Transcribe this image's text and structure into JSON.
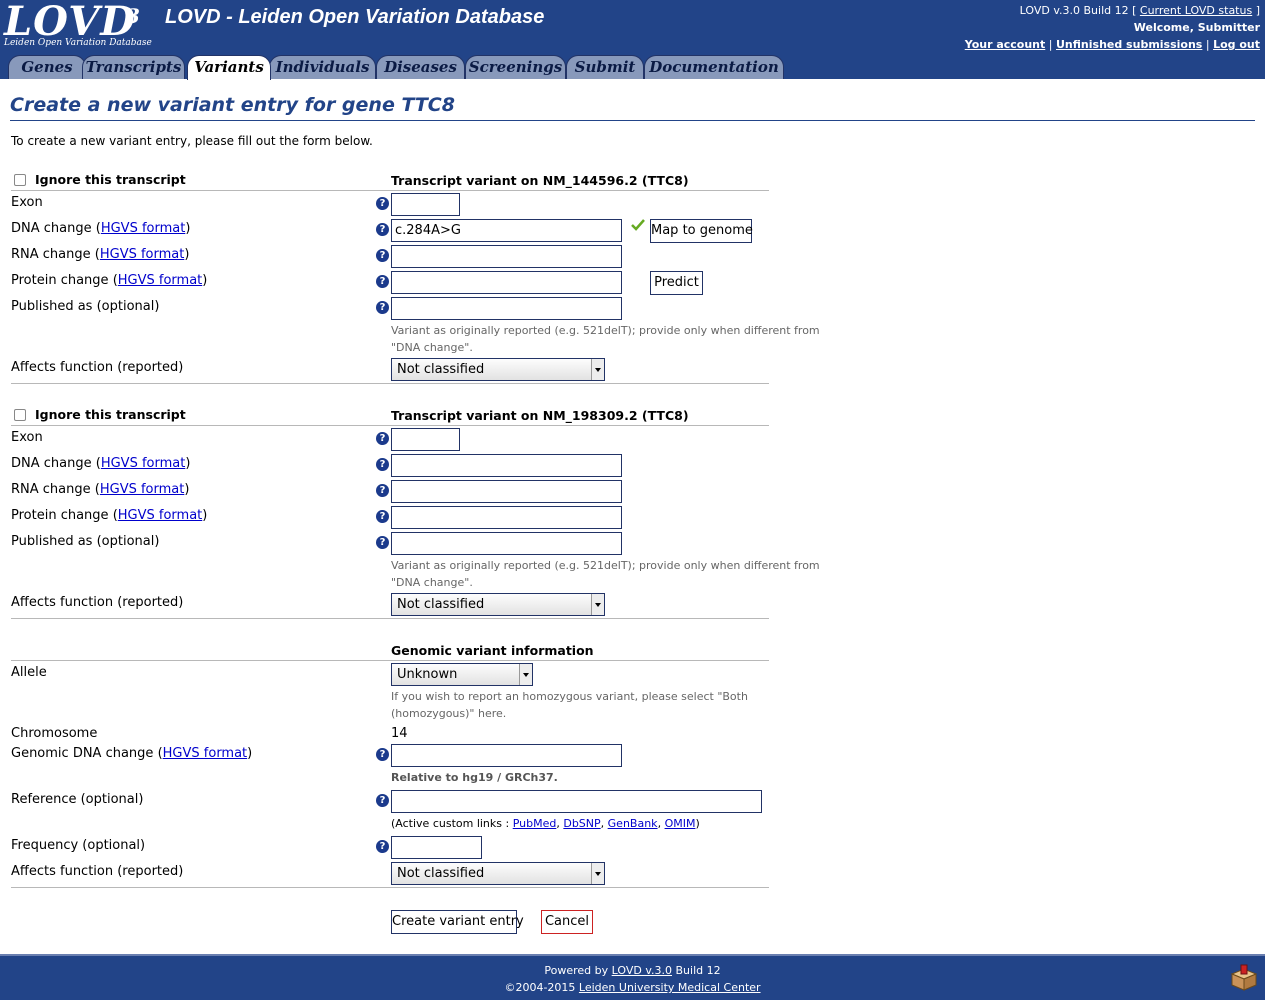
{
  "header": {
    "logo_text": "LOVD",
    "logo_superscript": "3",
    "logo_subtitle": "Leiden Open Variation Database",
    "title": "LOVD - Leiden Open Variation Database",
    "version_text": "LOVD v.3.0 Build 12 [",
    "version_link": "Current LOVD status",
    "version_close": "]",
    "welcome": "Welcome, Submitter",
    "your_account": "Your account",
    "unfinished_submissions": "Unfinished submissions",
    "log_out": "Log out",
    "separator": "|"
  },
  "tabs": [
    {
      "label": "Genes"
    },
    {
      "label": "Transcripts"
    },
    {
      "label": "Variants"
    },
    {
      "label": "Individuals"
    },
    {
      "label": "Diseases"
    },
    {
      "label": "Screenings"
    },
    {
      "label": "Submit"
    },
    {
      "label": "Documentation"
    }
  ],
  "active_tab": "Variants",
  "page": {
    "title": "Create a new variant entry for gene TTC8",
    "intro": "To create a new variant entry, please fill out the form below."
  },
  "common": {
    "hgvs_format": "HGVS format",
    "open_paren": "(",
    "close_paren": ")",
    "help_glyph": "?"
  },
  "transcript1": {
    "ignore_label": "Ignore this transcript",
    "heading": "Transcript variant on NM_144596.2 (TTC8)",
    "exon_label": "Exon",
    "dna_label": "DNA change",
    "dna_value": "c.284A>G",
    "rna_label": "RNA change",
    "protein_label": "Protein change",
    "published_label": "Published as (optional)",
    "published_note_1": "Variant as originally reported (e.g. 521delT); provide only when different from",
    "published_note_2": "\"DNA change\".",
    "affects_label": "Affects function (reported)",
    "affects_value": "Not classified",
    "map_button": "Map to genome",
    "predict_button": "Predict"
  },
  "transcript2": {
    "ignore_label": "Ignore this transcript",
    "heading": "Transcript variant on NM_198309.2 (TTC8)",
    "exon_label": "Exon",
    "dna_label": "DNA change",
    "rna_label": "RNA change",
    "protein_label": "Protein change",
    "published_label": "Published as (optional)",
    "published_note_1": "Variant as originally reported (e.g. 521delT); provide only when different from",
    "published_note_2": "\"DNA change\".",
    "affects_label": "Affects function (reported)",
    "affects_value": "Not classified"
  },
  "genomic": {
    "heading": "Genomic variant information",
    "allele_label": "Allele",
    "allele_value": "Unknown",
    "allele_note_1": "If you wish to report an homozygous variant, please select \"Both",
    "allele_note_2": "(homozygous)\" here.",
    "chromosome_label": "Chromosome",
    "chromosome_value": "14",
    "genomic_dna_label": "Genomic DNA change",
    "relative_note": "Relative to hg19 / GRCh37.",
    "reference_label": "Reference (optional)",
    "custom_links_prefix": "(Active custom links : ",
    "custom_links": [
      "PubMed",
      "DbSNP",
      "GenBank",
      "OMIM"
    ],
    "custom_links_sep": ", ",
    "custom_links_suffix": ")",
    "frequency_label": "Frequency (optional)",
    "affects_label": "Affects function (reported)",
    "affects_value": "Not classified"
  },
  "actions": {
    "create": "Create variant entry",
    "cancel": "Cancel"
  },
  "footer": {
    "powered_by": "Powered by ",
    "lovd_link": "LOVD v.3.0",
    "build": " Build 12",
    "copyright": "©2004-2015 ",
    "lumc_link": "Leiden University Medical Center"
  },
  "colors": {
    "header_bg": "#224488",
    "tab_bg": "#8899bb",
    "title_color": "#224488",
    "help_icon": "#1b3a8c",
    "check_mark": "#66aa22",
    "cancel_border": "#cc2222"
  }
}
